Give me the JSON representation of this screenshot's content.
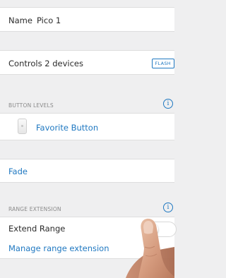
{
  "device_name": {
    "label": "Name",
    "value": "Pico 1"
  },
  "controls": {
    "label": "Controls 2 devices",
    "flash_label": "FLASH"
  },
  "button_levels": {
    "header": "BUTTON LEVELS",
    "info_glyph": "i",
    "favorite_button_label": "Favorite Button"
  },
  "fade": {
    "label": "Fade"
  },
  "range_extension": {
    "header": "RANGE EXTENSION",
    "info_glyph": "i",
    "extend_range_label": "Extend Range",
    "extend_range_on": false,
    "manage_label": "Manage range extension"
  },
  "colors": {
    "accent": "#1f78c1",
    "background": "#efeff0",
    "cell": "#ffffff"
  }
}
